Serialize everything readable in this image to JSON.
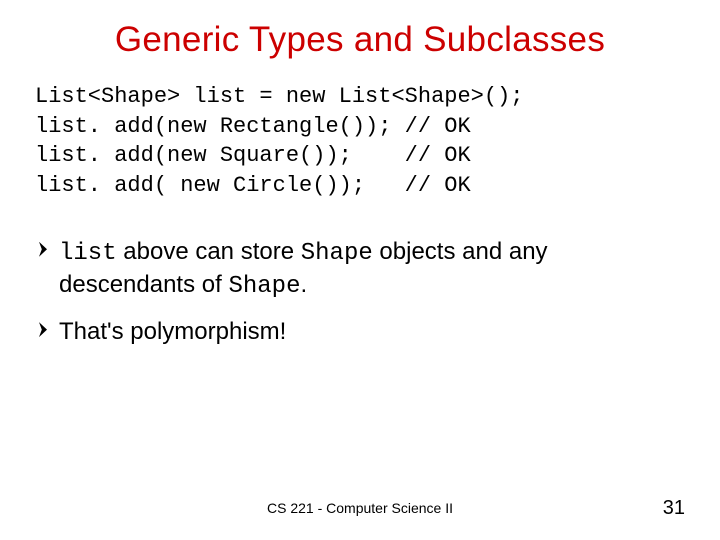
{
  "title": "Generic Types and Subclasses",
  "code": {
    "line1": "List<Shape> list = new List<Shape>();",
    "line2": "list. add(new Rectangle()); // OK",
    "line3": "list. add(new Square());    // OK",
    "line4": "list. add( new Circle());   // OK"
  },
  "bullets": {
    "b1": {
      "mono1": "list",
      "text1": " above can store ",
      "mono2": "Shape",
      "text2": " objects and any descendants of ",
      "mono3": "Shape",
      "text3": "."
    },
    "b2": "That's polymorphism!"
  },
  "footer": {
    "center": "CS 221 - Computer Science II",
    "page": "31"
  }
}
